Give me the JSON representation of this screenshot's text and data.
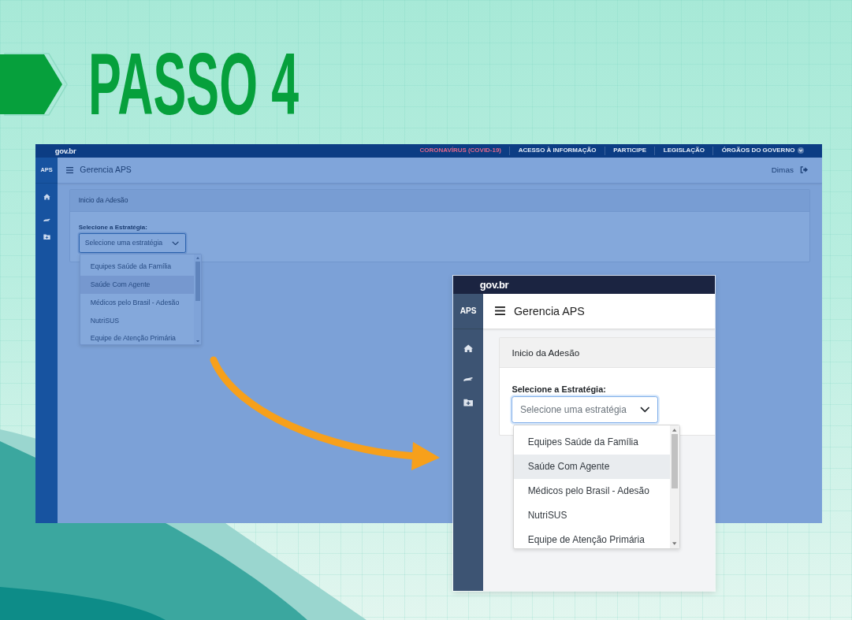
{
  "banner": {
    "title": "PASSO 4"
  },
  "screens": [
    {
      "kind": "backdrop",
      "gov_bar": {
        "logo": "gov.br",
        "links": [
          {
            "label": "CORONAVÍRUS (COVID-19)",
            "kind": "alert"
          },
          {
            "label": "ACESSO À INFORMAÇÃO",
            "kind": "link"
          },
          {
            "label": "PARTICIPE",
            "kind": "link"
          },
          {
            "label": "LEGISLAÇÃO",
            "kind": "link"
          },
          {
            "label": "ÓRGÃOS DO GOVERNO",
            "kind": "menu"
          }
        ]
      },
      "sidebar": {
        "title": "APS"
      },
      "header": {
        "title": "Gerencia APS",
        "user": "Dimas"
      },
      "card": {
        "title": "Inicio da Adesão",
        "field_label": "Selecione a Estratégia:",
        "select": {
          "placeholder": "Selecione uma estratégia",
          "expanded": true
        },
        "options": [
          {
            "label": "Equipes Saúde da Família",
            "selected": false
          },
          {
            "label": "Saúde Com Agente",
            "selected": true
          },
          {
            "label": "Médicos pelo Brasil - Adesão",
            "selected": false
          },
          {
            "label": "NutriSUS",
            "selected": false
          },
          {
            "label": "Equipe de Atenção Primária",
            "selected": false
          }
        ]
      }
    },
    {
      "kind": "inset",
      "gov_bar": {
        "logo": "gov.br"
      },
      "sidebar": {
        "title": "APS"
      },
      "header": {
        "title": "Gerencia APS"
      },
      "card": {
        "title": "Inicio da Adesão",
        "field_label": "Selecione a Estratégia:",
        "select": {
          "placeholder": "Selecione uma estratégia",
          "expanded": true
        },
        "options": [
          {
            "label": "Equipes Saúde da Família",
            "selected": false
          },
          {
            "label": "Saúde Com Agente",
            "selected": true
          },
          {
            "label": "Médicos pelo Brasil - Adesão",
            "selected": false
          },
          {
            "label": "NutriSUS",
            "selected": false
          },
          {
            "label": "Equipe de Atenção Primária",
            "selected": false
          }
        ]
      }
    }
  ]
}
